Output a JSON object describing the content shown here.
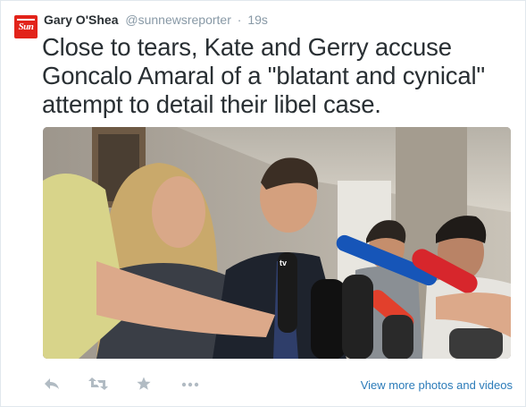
{
  "account": {
    "avatar_text": "Sun",
    "name": "Gary O'Shea",
    "handle": "@sunnewsreporter",
    "separator": "·",
    "time": "19s"
  },
  "tweet": {
    "text": "Close to tears, Kate and Gerry accuse Goncalo Amaral of a \"blatant and cynical\" attempt to detail their libel case."
  },
  "media": {
    "mic_logo": "tv"
  },
  "actions": {
    "reply_icon": "reply-icon",
    "retweet_icon": "retweet-icon",
    "favorite_icon": "star-icon",
    "more_icon": "more-icon",
    "view_more_label": "View more photos and videos"
  },
  "colors": {
    "brand_red": "#e2231a",
    "link_blue": "#2b7bb9",
    "muted": "#8899a6",
    "action_gray": "#b1bbc3"
  }
}
